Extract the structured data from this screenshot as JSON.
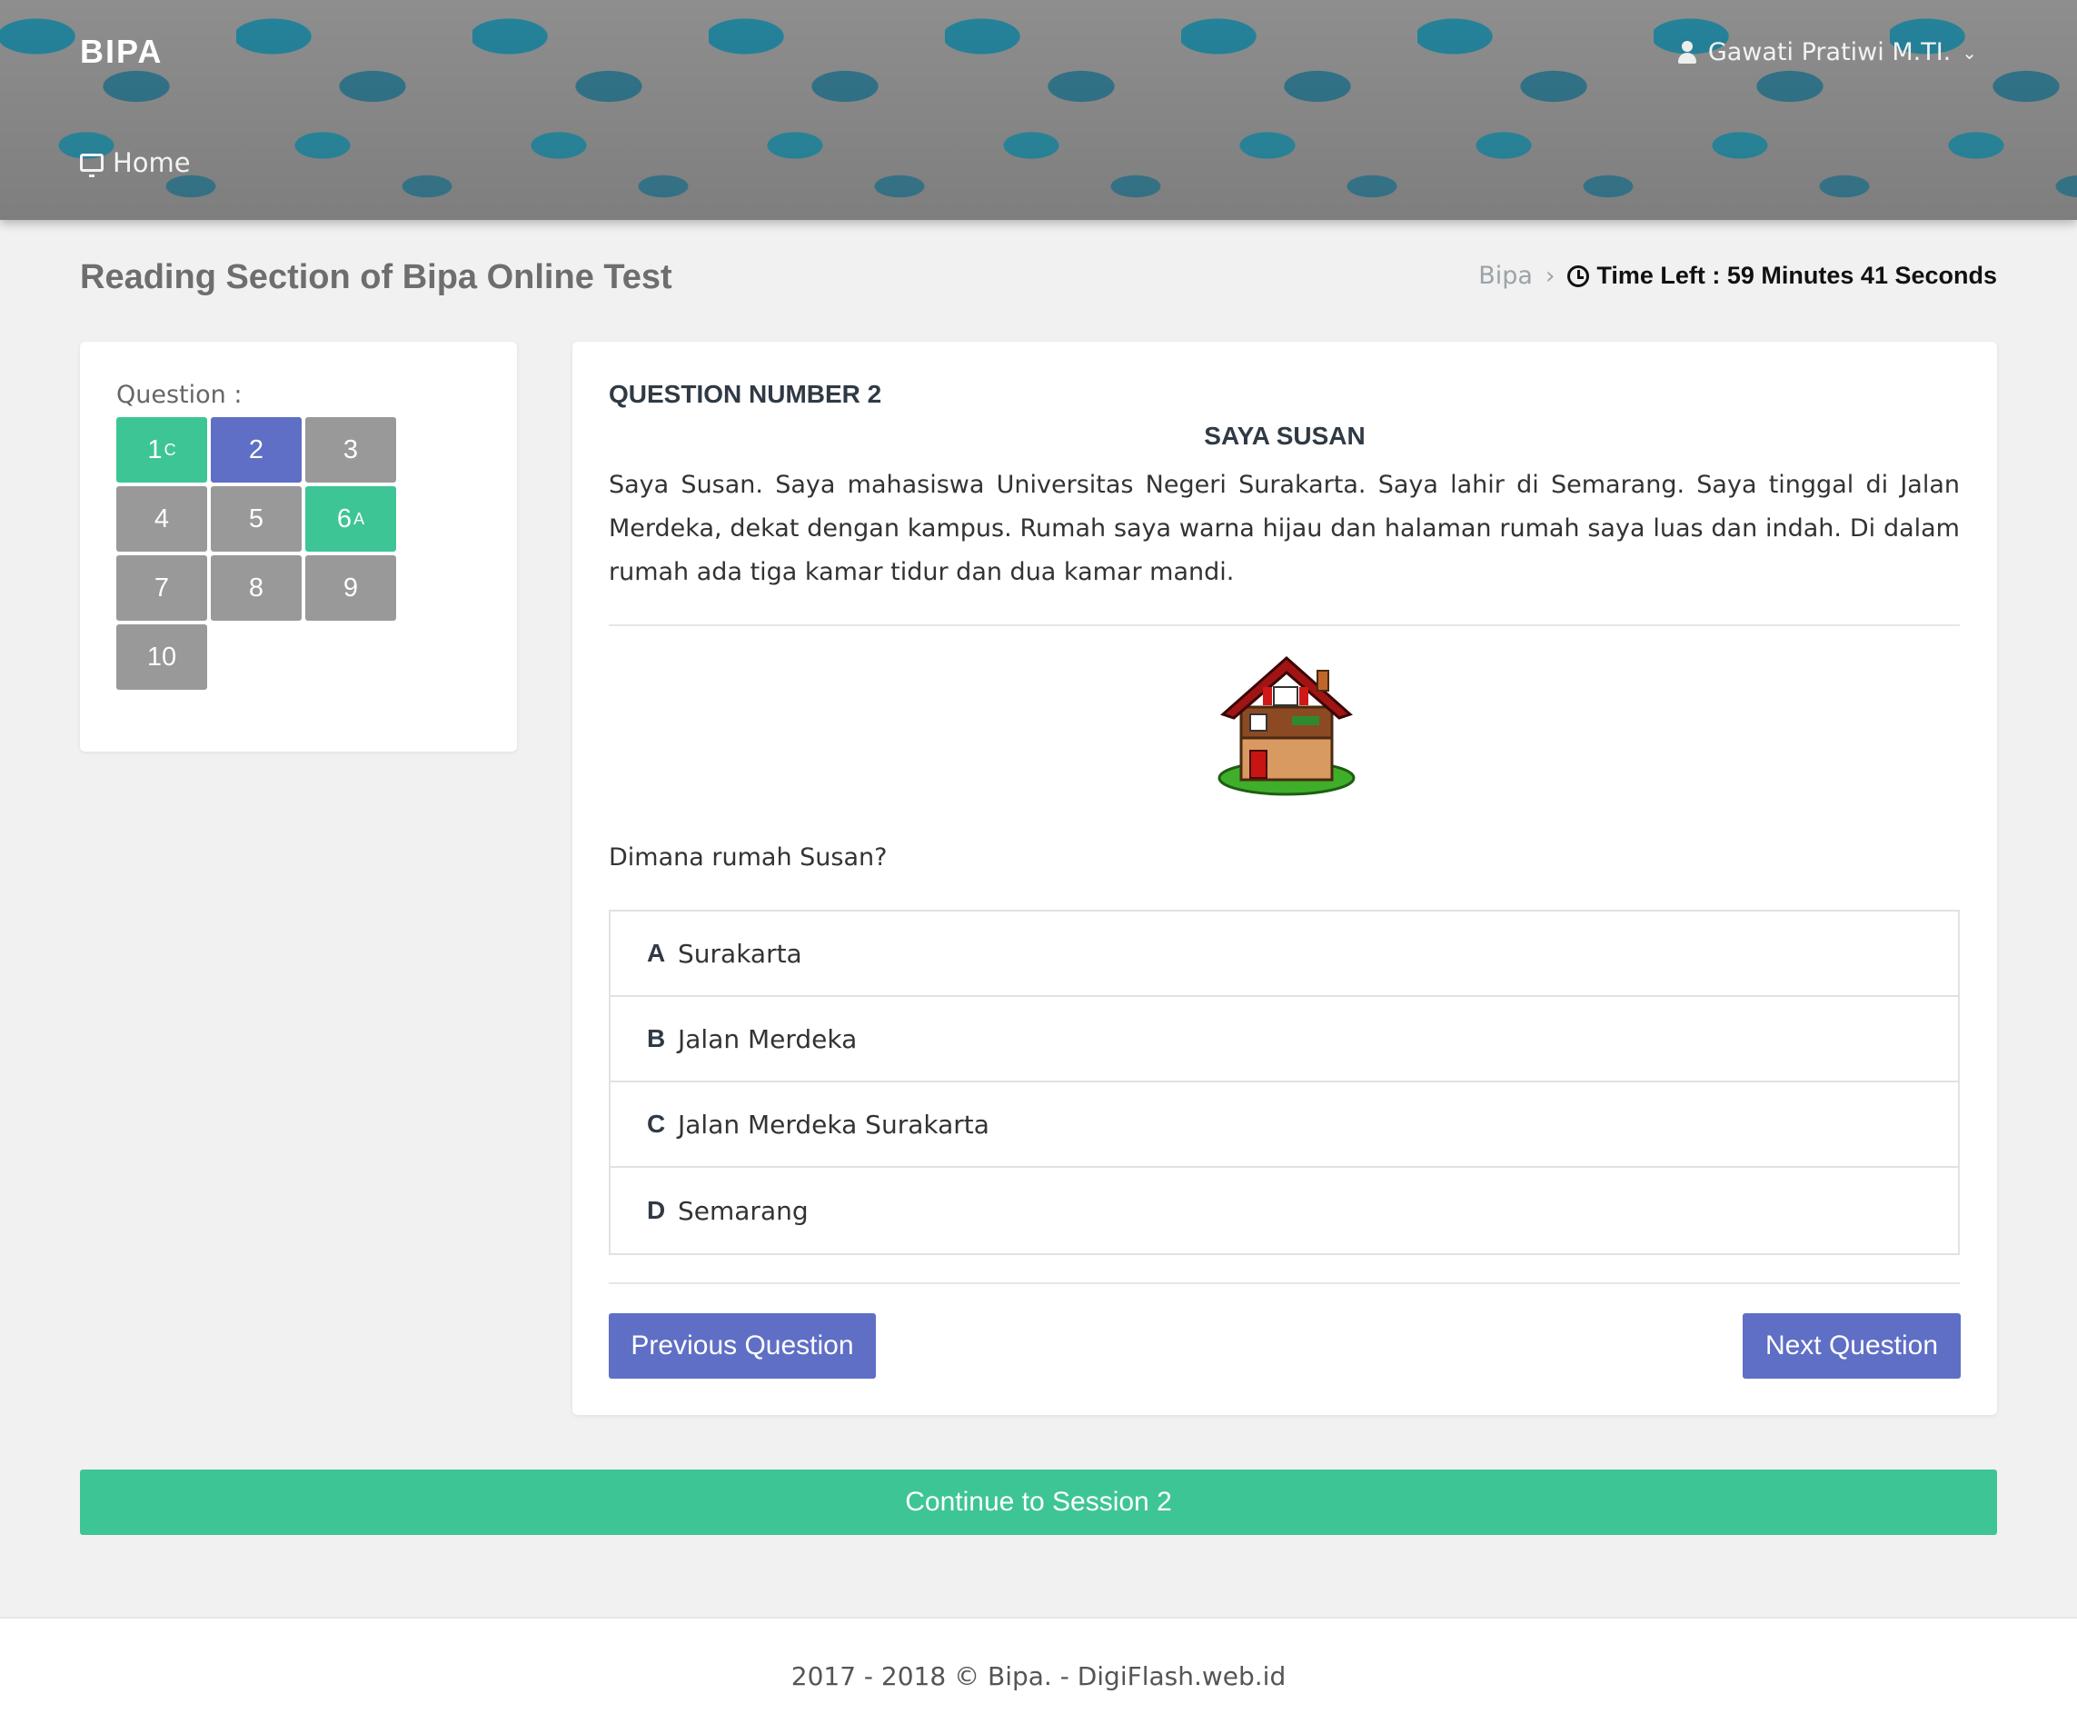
{
  "header": {
    "brand": "BIPA",
    "user_name": "Gawati Pratiwi M.TI.",
    "home_label": "Home"
  },
  "page": {
    "title": "Reading Section of Bipa Online Test",
    "breadcrumb": "Bipa",
    "timer": "Time Left : 59 Minutes 41 Seconds"
  },
  "nav": {
    "label": "Question :",
    "questions": [
      {
        "num": "1",
        "sub": "C",
        "state": "answered"
      },
      {
        "num": "2",
        "sub": "",
        "state": "current"
      },
      {
        "num": "3",
        "sub": "",
        "state": "unanswered"
      },
      {
        "num": "4",
        "sub": "",
        "state": "unanswered"
      },
      {
        "num": "5",
        "sub": "",
        "state": "unanswered"
      },
      {
        "num": "6",
        "sub": "A",
        "state": "answered"
      },
      {
        "num": "7",
        "sub": "",
        "state": "unanswered"
      },
      {
        "num": "8",
        "sub": "",
        "state": "unanswered"
      },
      {
        "num": "9",
        "sub": "",
        "state": "unanswered"
      },
      {
        "num": "10",
        "sub": "",
        "state": "unanswered"
      }
    ]
  },
  "question": {
    "number_label": "QUESTION NUMBER 2",
    "passage_title": "SAYA SUSAN",
    "passage": "Saya Susan. Saya mahasiswa Universitas Negeri Surakarta. Saya lahir di Semarang. Saya tinggal di Jalan Merdeka, dekat dengan kampus. Rumah saya warna hijau dan halaman rumah saya luas dan indah. Di dalam rumah ada tiga kamar tidur dan dua kamar mandi.",
    "prompt": "Dimana rumah Susan?",
    "options": [
      {
        "letter": "A",
        "text": "Surakarta"
      },
      {
        "letter": "B",
        "text": "Jalan Merdeka"
      },
      {
        "letter": "C",
        "text": "Jalan Merdeka Surakarta"
      },
      {
        "letter": "D",
        "text": "Semarang"
      }
    ],
    "prev_label": "Previous Question",
    "next_label": "Next Question"
  },
  "continue_label": "Continue to Session 2",
  "footer": "2017 - 2018 © Bipa. - DigiFlash.web.id",
  "colors": {
    "answered": "#3ec596",
    "current": "#5f6fc6",
    "unanswered": "#999999",
    "primary_button": "#5f6fc6"
  }
}
